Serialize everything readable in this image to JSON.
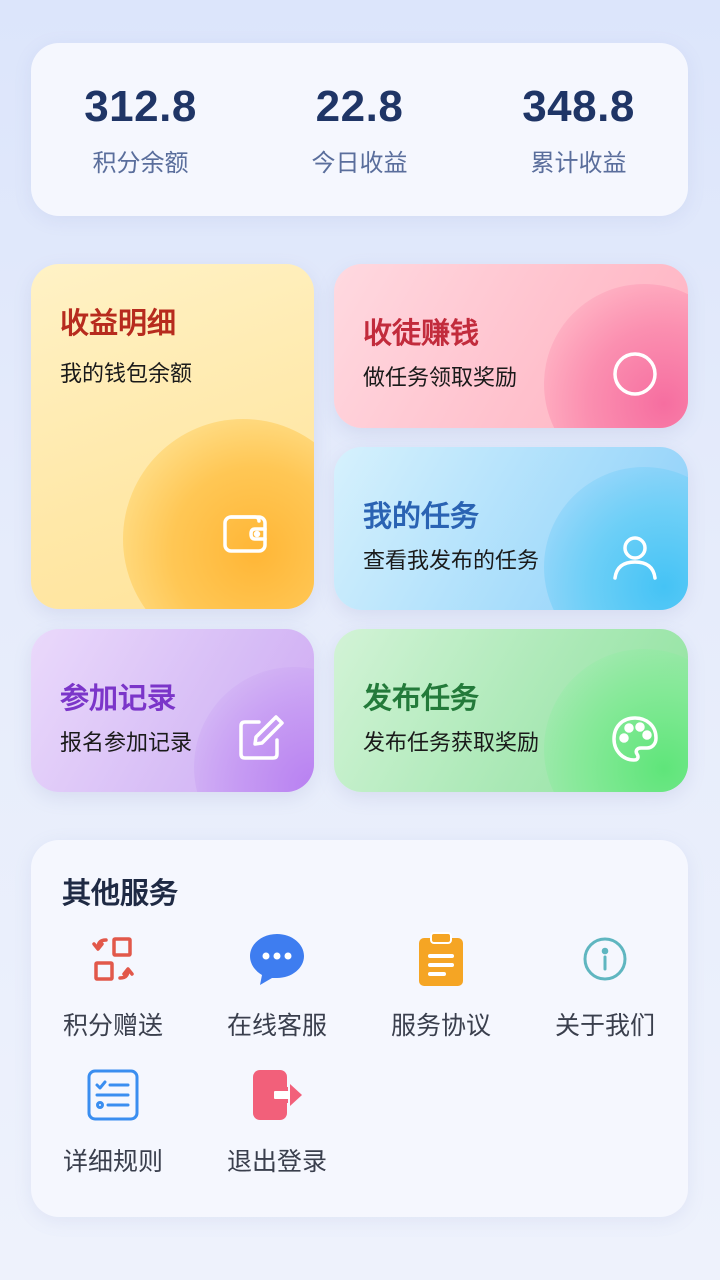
{
  "stats": [
    {
      "value": "312.8",
      "label": "积分余额"
    },
    {
      "value": "22.8",
      "label": "今日收益"
    },
    {
      "value": "348.8",
      "label": "累计收益"
    }
  ],
  "cards": {
    "income_detail": {
      "title": "收益明细",
      "subtitle": "我的钱包余额",
      "icon": "wallet-icon"
    },
    "recruit": {
      "title": "收徒赚钱",
      "subtitle": "做任务领取奖励",
      "icon": "circle-icon"
    },
    "my_tasks": {
      "title": "我的任务",
      "subtitle": "查看我发布的任务",
      "icon": "user-icon"
    },
    "join_records": {
      "title": "参加记录",
      "subtitle": "报名参加记录",
      "icon": "edit-icon"
    },
    "publish_task": {
      "title": "发布任务",
      "subtitle": "发布任务获取奖励",
      "icon": "palette-icon"
    }
  },
  "services": {
    "title": "其他服务",
    "items": [
      {
        "label": "积分赠送",
        "icon": "transfer-icon",
        "color": "#e2584a"
      },
      {
        "label": "在线客服",
        "icon": "chat-icon",
        "color": "#3e7df0"
      },
      {
        "label": "服务协议",
        "icon": "clipboard-icon",
        "color": "#f5a524"
      },
      {
        "label": "关于我们",
        "icon": "info-icon",
        "color": "#5fb6c0"
      },
      {
        "label": "详细规则",
        "icon": "checklist-icon",
        "color": "#3a8ef0"
      },
      {
        "label": "退出登录",
        "icon": "logout-icon",
        "color": "#f2607a"
      }
    ]
  }
}
